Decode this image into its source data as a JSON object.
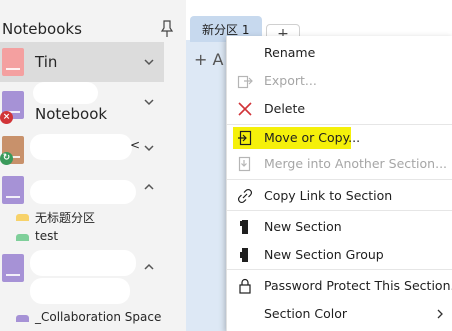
{
  "notebooks_panel": {
    "title": "Notebooks",
    "notebooks": [
      {
        "label": "Tin",
        "color": "#f4a0a0",
        "expanded": false
      },
      {
        "label": "Notebook",
        "color": "#a692d6",
        "expanded": false,
        "badge": "error"
      },
      {
        "label": "",
        "color": "#c8916b",
        "expanded": false,
        "badge": "sync",
        "trailing_text": "<"
      },
      {
        "label": "",
        "color": "#a692d6",
        "expanded": true
      },
      {
        "label": "",
        "color": "#a692d6",
        "expanded": true
      }
    ],
    "sections": [
      {
        "label": "无标题分区",
        "color": "#f7d26a"
      },
      {
        "label": "test",
        "color": "#7fcf9a"
      },
      {
        "label": "_Collaboration Space",
        "color": "#a692d6"
      }
    ]
  },
  "section_tabs": {
    "active_label": "新分区 1",
    "add_label": "+"
  },
  "page_list": {
    "add_page_label": "+ A"
  },
  "context_menu": {
    "items": [
      {
        "label": "Rename",
        "icon": "none",
        "disabled": false
      },
      {
        "label": "Export...",
        "icon": "export-icon",
        "disabled": true
      },
      {
        "label": "Delete",
        "icon": "delete-x-icon",
        "disabled": false
      },
      {
        "label": "Move or Copy...",
        "icon": "move-copy-icon",
        "disabled": false,
        "highlighted": true
      },
      {
        "label": "Merge into Another Section...",
        "icon": "merge-icon",
        "disabled": true
      },
      {
        "label": "Copy Link to Section",
        "icon": "link-icon",
        "disabled": false
      },
      {
        "label": "New Section",
        "icon": "section-tab-icon",
        "disabled": false
      },
      {
        "label": "New Section Group",
        "icon": "section-group-icon",
        "disabled": false
      },
      {
        "label": "Password Protect This Section...",
        "icon": "lock-icon",
        "disabled": false
      },
      {
        "label": "Section Color",
        "icon": "none",
        "disabled": false,
        "submenu": true
      }
    ],
    "highlight_color": "#f5f00a",
    "delete_icon_color": "#d13438"
  }
}
